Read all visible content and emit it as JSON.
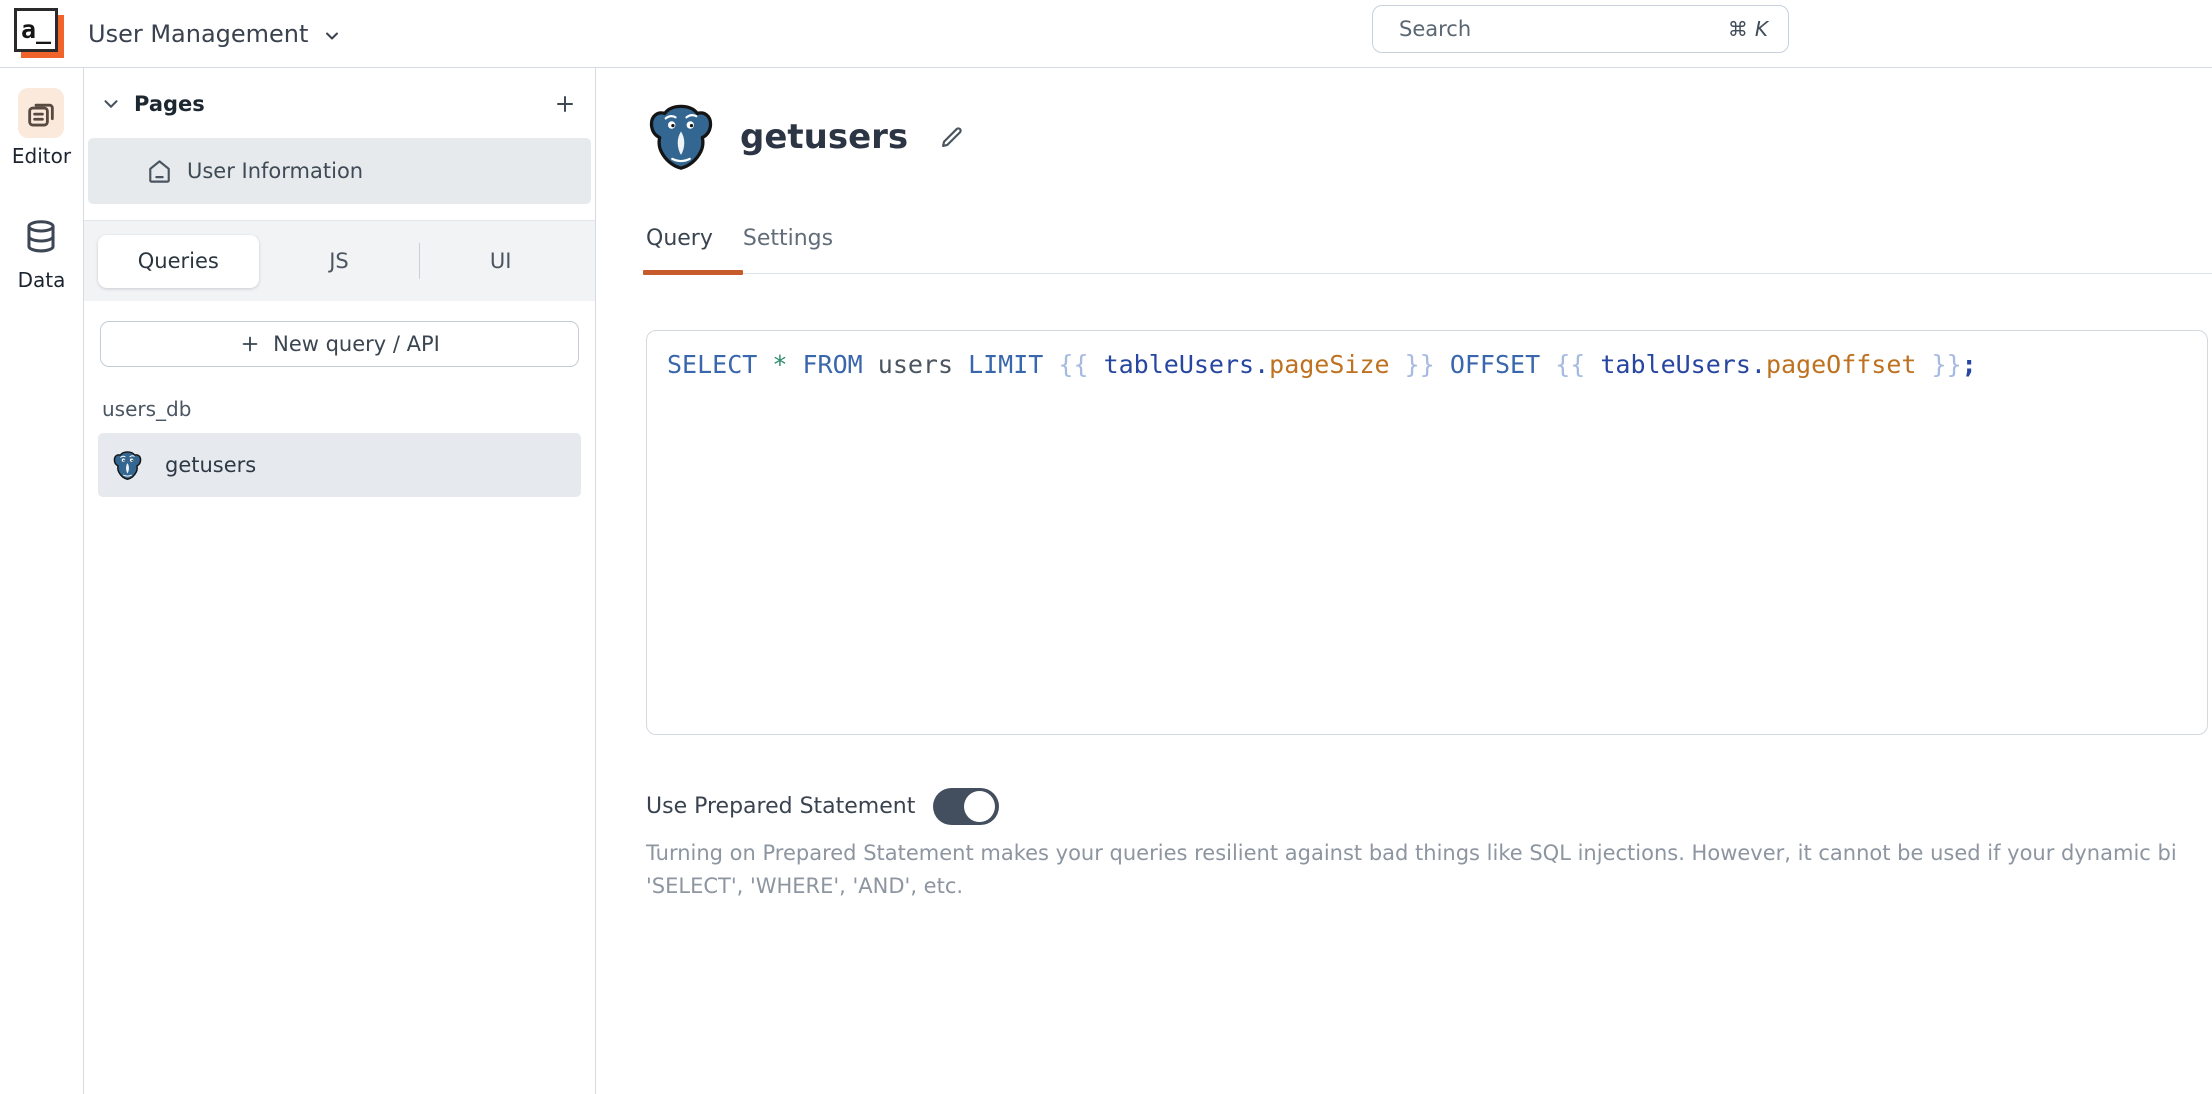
{
  "topbar": {
    "logo_text": "a_",
    "app_title": "User Management",
    "search_placeholder": "Search",
    "search_shortcut_mod": "⌘",
    "search_shortcut_key": "K"
  },
  "left_rail": {
    "items": [
      {
        "label": "Editor",
        "icon": "pages-editor-icon",
        "active": true
      },
      {
        "label": "Data",
        "icon": "database-icon",
        "active": false
      }
    ]
  },
  "pages_panel": {
    "title": "Pages",
    "pages": [
      {
        "label": "User Information",
        "icon": "home-icon",
        "selected": true
      }
    ],
    "segments": [
      {
        "label": "Queries",
        "active": true
      },
      {
        "label": "JS",
        "active": false
      },
      {
        "label": "UI",
        "active": false
      }
    ],
    "new_query_label": "New query / API",
    "datasource_group": "users_db",
    "queries": [
      {
        "label": "getusers",
        "icon": "postgresql-icon",
        "selected": true
      }
    ]
  },
  "main": {
    "query_title": "getusers",
    "tabs": [
      {
        "label": "Query",
        "active": true
      },
      {
        "label": "Settings",
        "active": false
      }
    ],
    "sql_tokens": [
      [
        "kw",
        "SELECT"
      ],
      [
        "pl",
        " "
      ],
      [
        "st",
        "*"
      ],
      [
        "pl",
        " "
      ],
      [
        "kw",
        "FROM"
      ],
      [
        "pl",
        " users "
      ],
      [
        "kw",
        "LIMIT"
      ],
      [
        "pl",
        " "
      ],
      [
        "br",
        "{{"
      ],
      [
        "pl",
        " "
      ],
      [
        "ob",
        "tableUsers"
      ],
      [
        "dt",
        "."
      ],
      [
        "pr",
        "pageSize"
      ],
      [
        "pl",
        " "
      ],
      [
        "br",
        "}}"
      ],
      [
        "pl",
        " "
      ],
      [
        "kw",
        "OFFSET"
      ],
      [
        "pl",
        " "
      ],
      [
        "br",
        "{{"
      ],
      [
        "pl",
        " "
      ],
      [
        "ob",
        "tableUsers"
      ],
      [
        "dt",
        "."
      ],
      [
        "pr",
        "pageOffset"
      ],
      [
        "pl",
        " "
      ],
      [
        "br",
        "}}"
      ],
      [
        "sm",
        ";"
      ]
    ],
    "prepared": {
      "label": "Use Prepared Statement",
      "state": "on",
      "help_line1": "Turning on Prepared Statement makes your queries resilient against bad things like SQL injections. However, it cannot be used if your dynamic bi",
      "help_line2": "'SELECT', 'WHERE', 'AND', etc."
    }
  },
  "colors": {
    "accent_orange": "#C75B2B",
    "logo_orange": "#F0642C",
    "postgres_blue": "#336791",
    "toggle_on": "#434E5E",
    "selected_row_bg": "#E6EAEF",
    "panel_border": "#D6DBE1"
  }
}
